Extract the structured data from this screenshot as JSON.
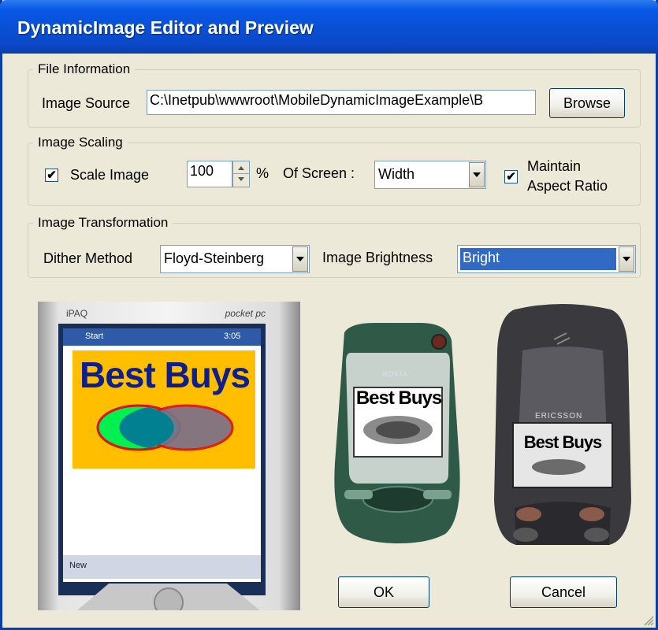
{
  "window": {
    "title": "DynamicImage Editor and Preview"
  },
  "file_info": {
    "group_label": "File Information",
    "source_label": "Image Source",
    "source_value": "C:\\Inetpub\\wwwroot\\MobileDynamicImageExample\\B",
    "browse_label": "Browse"
  },
  "scaling": {
    "group_label": "Image Scaling",
    "scale_checkbox_label": "Scale Image",
    "scale_checked": true,
    "percent_value": "100",
    "percent_symbol": "%",
    "of_screen_label": "Of Screen :",
    "dimension_value": "Width",
    "maintain_line1": "Maintain",
    "maintain_line2": "Aspect Ratio",
    "maintain_checked": true
  },
  "transformation": {
    "group_label": "Image Transformation",
    "dither_label": "Dither Method",
    "dither_value": "Floyd-Steinberg",
    "brightness_label": "Image Brightness",
    "brightness_value": "Bright"
  },
  "previews": {
    "pocketpc": {
      "brand": "iPAQ",
      "model": "pocket pc",
      "start": "Start",
      "time": "3:05",
      "bottom": "New",
      "image_text": "Best Buys"
    },
    "nokia": {
      "brand": "NOKIA",
      "image_text": "Best Buys"
    },
    "ericsson": {
      "brand": "ERICSSON",
      "image_text": "Best Buys"
    }
  },
  "buttons": {
    "ok": "OK",
    "cancel": "Cancel"
  },
  "colors": {
    "titlebar": "#0a52dc",
    "selection": "#316ac5",
    "dialog_bg": "#ece9d8"
  }
}
